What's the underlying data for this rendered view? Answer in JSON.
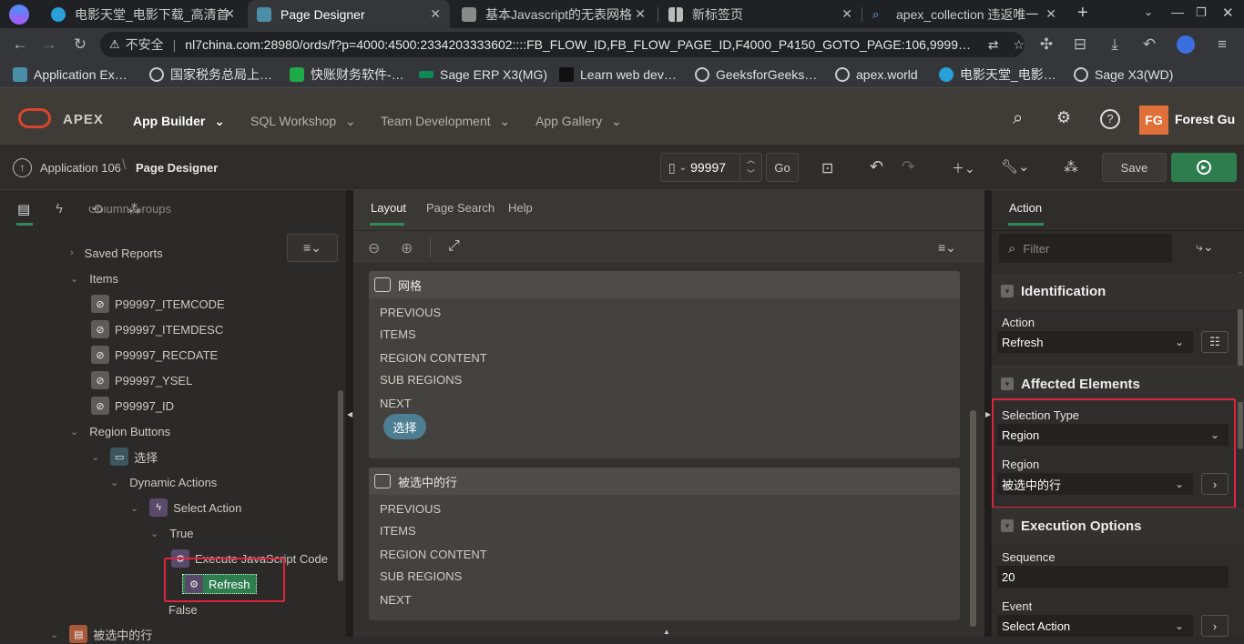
{
  "browser": {
    "tabs": [
      {
        "title": "电影天堂_电影下载_高清首",
        "active": false
      },
      {
        "title": "Page Designer",
        "active": true
      },
      {
        "title": "基本Javascript的无表网格",
        "active": false
      },
      {
        "title": "新标签页",
        "active": false
      },
      {
        "title": "apex_collection 违返唯一",
        "active": false
      }
    ],
    "new_tab": "+",
    "security_label": "不安全",
    "url": "nl7china.com:28980/ords/f?p=4000:4500:2334203333602::::FB_FLOW_ID,FB_FLOW_PAGE_ID,F4000_P4150_GOTO_PAGE:106,9999…",
    "bookmarks": [
      "Application Ex…",
      "国家税务总局上…",
      "快账财务软件-…",
      "Sage ERP X3(MG)",
      "Learn web dev…",
      "GeeksforGeeks…",
      "apex.world",
      "电影天堂_电影…",
      "Sage X3(WD)"
    ]
  },
  "apex": {
    "logo": "APEX",
    "nav": [
      "App Builder",
      "SQL Workshop",
      "Team Development",
      "App Gallery"
    ],
    "user_initials": "FG",
    "user_name": "Forest Gu"
  },
  "toolbar": {
    "breadcrumb_app": "Application 106",
    "breadcrumb_page": "Page Designer",
    "page_number": "99997",
    "go": "Go",
    "save": "Save"
  },
  "left_tree": [
    {
      "label": "Column Groups",
      "indent": 2,
      "chevron": "",
      "icon": ""
    },
    {
      "label": "Saved Reports",
      "indent": 2,
      "chevron": "›",
      "icon": ""
    },
    {
      "label": "Items",
      "indent": 2,
      "chevron": "⌄",
      "icon": ""
    },
    {
      "label": "P99997_ITEMCODE",
      "indent": 3,
      "chevron": "",
      "icon": "hidden"
    },
    {
      "label": "P99997_ITEMDESC",
      "indent": 3,
      "chevron": "",
      "icon": "hidden"
    },
    {
      "label": "P99997_RECDATE",
      "indent": 3,
      "chevron": "",
      "icon": "hidden"
    },
    {
      "label": "P99997_YSEL",
      "indent": 3,
      "chevron": "",
      "icon": "hidden"
    },
    {
      "label": "P99997_ID",
      "indent": 3,
      "chevron": "",
      "icon": "hidden"
    },
    {
      "label": "Region Buttons",
      "indent": 2,
      "chevron": "⌄",
      "icon": ""
    },
    {
      "label": "选择",
      "indent": 3,
      "chevron": "⌄",
      "icon": "button"
    },
    {
      "label": "Dynamic Actions",
      "indent": 4,
      "chevron": "⌄",
      "icon": ""
    },
    {
      "label": "Select Action",
      "indent": 5,
      "chevron": "⌄",
      "icon": "lightning"
    },
    {
      "label": "True",
      "indent": 6,
      "chevron": "⌄",
      "icon": ""
    },
    {
      "label": "Execute JavaScript Code",
      "indent": 7,
      "chevron": "",
      "icon": "gear"
    },
    {
      "label": "Refresh",
      "indent": 7,
      "chevron": "",
      "icon": "gear-selected"
    },
    {
      "label": "False",
      "indent": 6,
      "chevron": "",
      "icon": ""
    },
    {
      "label": "被选中的行",
      "indent": 1,
      "chevron": "⌄",
      "icon": "region"
    }
  ],
  "middle": {
    "tabs": [
      "Layout",
      "Page Search",
      "Help"
    ],
    "regions": [
      {
        "title": "网格",
        "slots": [
          "PREVIOUS",
          "ITEMS",
          "REGION CONTENT",
          "SUB REGIONS",
          "NEXT"
        ],
        "button": "选择"
      },
      {
        "title": "被选中的行",
        "slots": [
          "PREVIOUS",
          "ITEMS",
          "REGION CONTENT",
          "SUB REGIONS",
          "NEXT"
        ],
        "button": ""
      }
    ]
  },
  "right": {
    "tab": "Action",
    "filter_placeholder": "Filter",
    "sections": {
      "identification": "Identification",
      "affected": "Affected Elements",
      "execution": "Execution Options"
    },
    "fields": {
      "action_label": "Action",
      "action_value": "Refresh",
      "selection_type_label": "Selection Type",
      "selection_type_value": "Region",
      "region_label": "Region",
      "region_value": "被选中的行",
      "sequence_label": "Sequence",
      "sequence_value": "20",
      "event_label": "Event",
      "event_value": "Select Action"
    }
  },
  "colors": {
    "accent_green": "#2e7d4f",
    "highlight_red": "#e0243f",
    "apex_red": "#d9462e",
    "avatar_orange": "#e0703a"
  }
}
